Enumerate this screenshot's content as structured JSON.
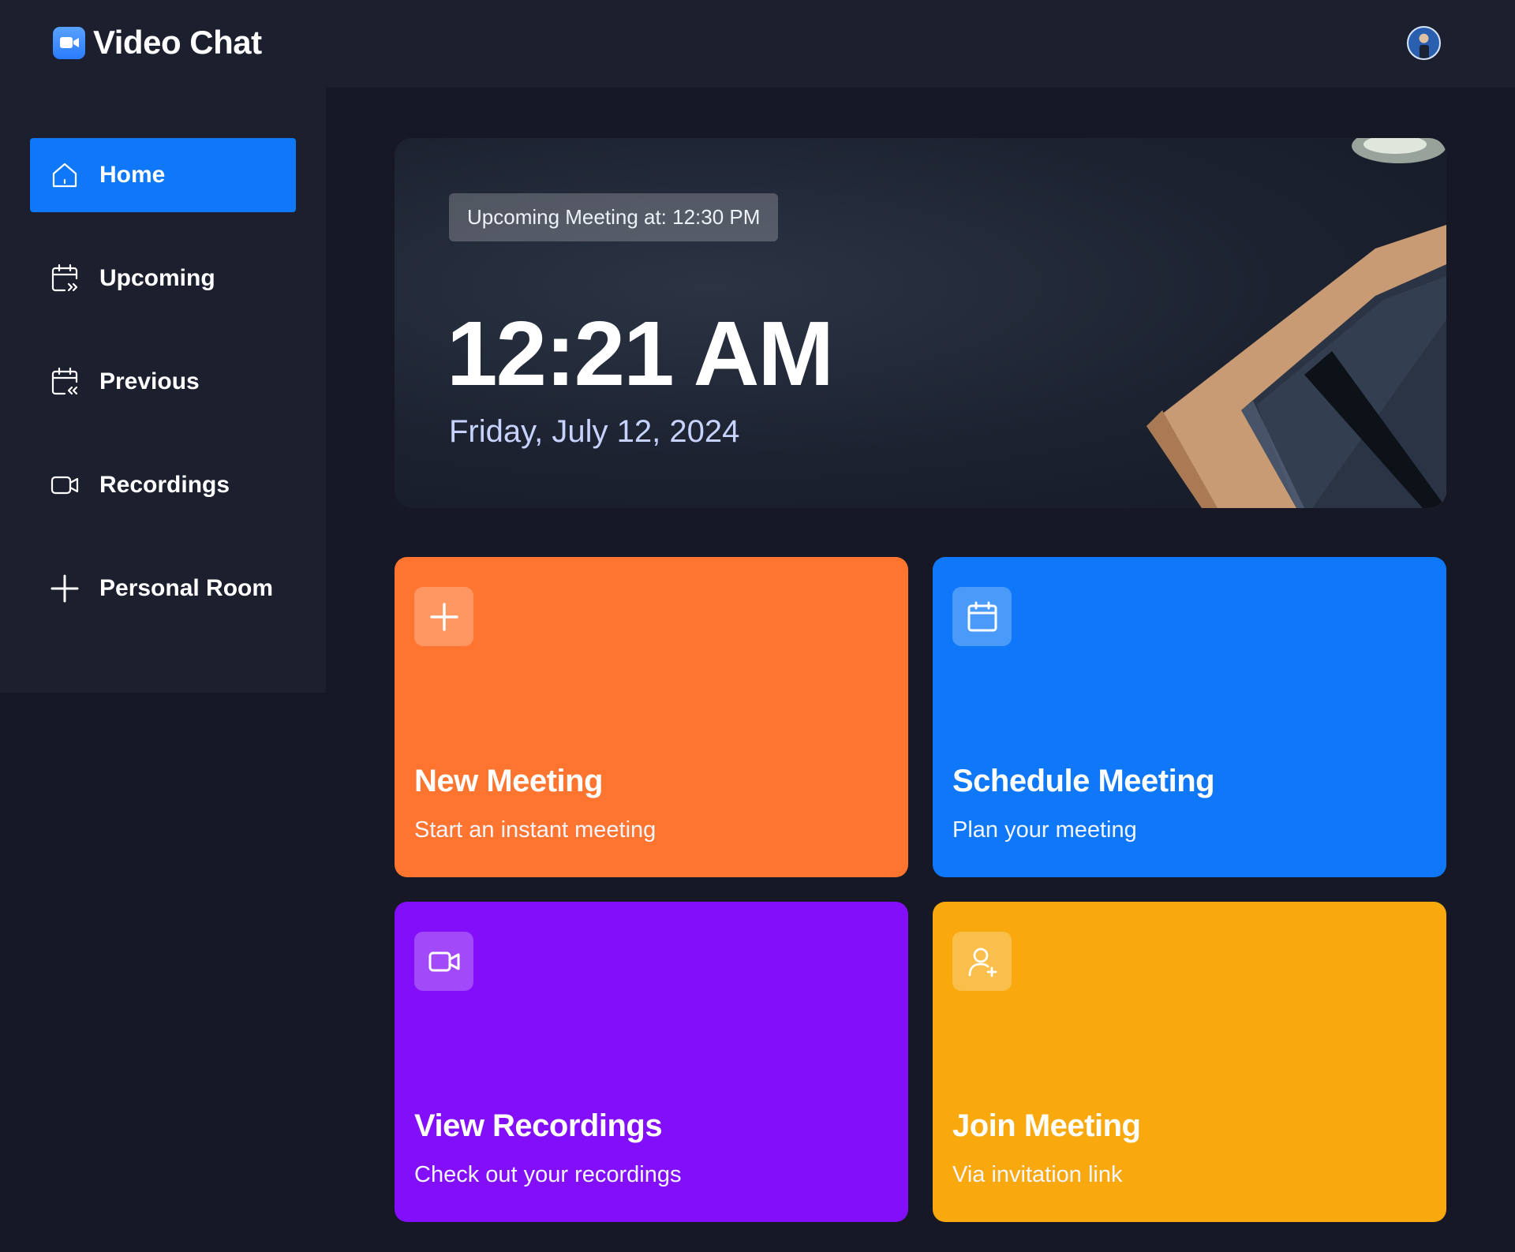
{
  "app": {
    "title": "Video Chat"
  },
  "nav": {
    "home": "Home",
    "upcoming": "Upcoming",
    "previous": "Previous",
    "recordings": "Recordings",
    "personal_room": "Personal Room"
  },
  "hero": {
    "badge": "Upcoming Meeting at: 12:30 PM",
    "time": "12:21 AM",
    "date": "Friday, July 12, 2024"
  },
  "cards": {
    "new_meeting": {
      "title": "New Meeting",
      "subtitle": "Start an instant meeting",
      "icon": "plus-icon"
    },
    "schedule_meeting": {
      "title": "Schedule Meeting",
      "subtitle": "Plan your meeting",
      "icon": "calendar-icon"
    },
    "view_recordings": {
      "title": "View Recordings",
      "subtitle": "Check out your recordings",
      "icon": "video-icon"
    },
    "join_meeting": {
      "title": "Join Meeting",
      "subtitle": "Via invitation link",
      "icon": "add-user-icon"
    }
  },
  "colors": {
    "orange": "#ff742e",
    "blue": "#0e78f9",
    "purple": "#830ef9",
    "yellow": "#f9a90e",
    "background": "#161925",
    "panel": "#1c1f2e"
  }
}
